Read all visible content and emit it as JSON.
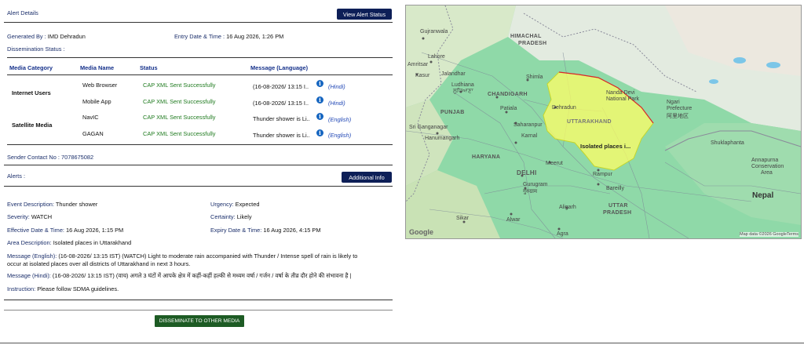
{
  "alert_details": {
    "heading": "Alert Details",
    "view_button": "View Alert Status",
    "generated_by_label": "Generated By :",
    "generated_by_value": "IMD Dehradun",
    "entry_label": "Entry Date & Time :",
    "entry_value": "16 Aug 2026, 1:26 PM",
    "dissemination_label": "Dissemination Status :"
  },
  "table": {
    "headers": [
      "Media Category",
      "Media Name",
      "Status",
      "Message (Language)"
    ],
    "categories": [
      "Internet Users",
      "Satellite Media"
    ],
    "rows": [
      {
        "name": "Web Browser",
        "status": "CAP XML Sent Successfully",
        "message": "(16-08-2026/ 13:15 I..",
        "lang": "(Hindi)"
      },
      {
        "name": "Mobile App",
        "status": "CAP XML Sent Successfully",
        "message": "(16-08-2026/ 13:15 I..",
        "lang": "(Hindi)"
      },
      {
        "name": "NavIC",
        "status": "CAP XML Sent Successfully",
        "message": "Thunder shower is Li..",
        "lang": "(English)"
      },
      {
        "name": "GAGAN",
        "status": "CAP XML Sent Successfully",
        "message": "Thunder shower is Li..",
        "lang": "(English)"
      }
    ]
  },
  "sender_contact": "Sender Contact No : 7078675082",
  "alerts": {
    "heading": "Alerts :",
    "info_button": "Additional Info",
    "event_label": "Event Description:",
    "event_value": "Thunder shower",
    "urgency_label": "Urgency:",
    "urgency_value": "Expected",
    "severity_label": "Severity:",
    "severity_value": "WATCH",
    "certainty_label": "Certainty:",
    "certainty_value": "Likely",
    "effective_label": "Effective Date & Time:",
    "effective_value": "16 Aug 2026, 1:15 PM",
    "expiry_label": "Expiry Date & Time:",
    "expiry_value": "16 Aug 2026, 4:15 PM",
    "area_label": "Area Description:",
    "area_value": "Isolated places in Uttarakhand",
    "msg_en_label": "Message (English):",
    "msg_en_value_1": "(16-08-2026/ 13:15 IST) (WATCH) Light to moderate rain accompanied with Thunder / Intense spell of rain is likely to",
    "msg_en_value_2": "occur at isolated places over all districts of Uttarakhand in next 3 hours.",
    "msg_hi_label": "Message (Hindi):",
    "msg_hi_value": "(16-08-2026/ 13:15 IST) (वाच) अगले 3 घंटों में आपके क्षेत्र में कहीं-कहीं हल्की से मध्यम वर्षा / गर्जन / वर्षा के तीव्र दौर होने की संभावना है |",
    "instruction_label": "Instruction:",
    "instruction_value": "Please follow SDMA guidelines."
  },
  "disseminate_button": "DISSEMINATE TO OTHER MEDIA",
  "map": {
    "labels": {
      "himachal": "HIMACHAL",
      "pradesh": "PRADESH",
      "gujranwala": "Gujranwala",
      "lahore": "Lahore",
      "amritsar": "Amritsar",
      "kasur": "Kasur",
      "jalandhar": "Jalandhar",
      "ludhiana": "Ludhiana",
      "ludhiana_hi": "ਲੁਧਿਆਣਾ",
      "chandigarh": "CHANDIGARH",
      "shimla": "Shimla",
      "punjab": "PUNJAB",
      "patiala": "Patiala",
      "sri_ganganagar": "Sri Ganganagar",
      "hanumangarh": "Hanumangarh",
      "saharanpur": "Saharanpur",
      "karnal": "Karnal",
      "haryana": "HARYANA",
      "delhi": "DELHI",
      "meerut": "Meerut",
      "gurugram": "Gurugram",
      "gurugram_hi": "गुरुग्राम",
      "aligarh": "Aligarh",
      "alwar": "Alwar",
      "sikar": "Sikar",
      "agra": "Agra",
      "uttar": "UTTAR",
      "pradesh2": "PRADESH",
      "uttarakhand": "UTTARAKHAND",
      "dehradun": "Dehradun",
      "nanda_devi": "Nanda Devi",
      "national_park": "National Park",
      "ngari": "Ngari",
      "prefecture": "Prefecture",
      "prefecture_cn": "阿里地区",
      "nepal": "Nepal",
      "sukla_phanta": "Shuklaphanta",
      "annapurna": "Annapurna",
      "conservation": "Conservation",
      "area": "Area",
      "bareilly": "Bareilly",
      "rampur": "Rampur",
      "isolated": "Isolated places i...",
      "google": "Google",
      "attrib": "Map data ©2026 Google",
      "terms": "Terms"
    }
  }
}
